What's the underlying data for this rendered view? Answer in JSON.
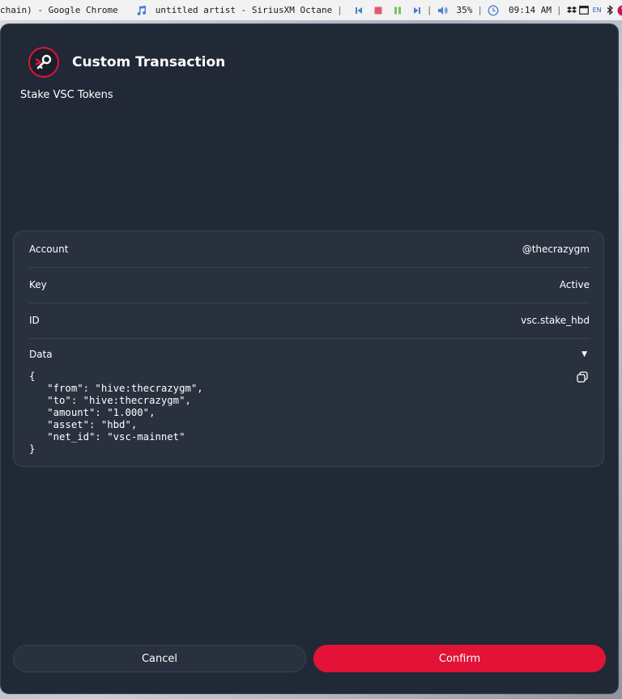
{
  "topbar": {
    "window_title": "chain) - Google Chrome",
    "now_playing": "untitled artist - SiriusXM Octane",
    "volume": "35%",
    "clock": "09:14 AM",
    "lang": "EN"
  },
  "popup": {
    "title": "Custom Transaction",
    "subtitle": "Stake VSC Tokens"
  },
  "details": {
    "account_label": "Account",
    "account_value": "@thecrazygm",
    "key_label": "Key",
    "key_value": "Active",
    "id_label": "ID",
    "id_value": "vsc.stake_hbd",
    "data_label": "Data",
    "data_json": "{\n   \"from\": \"hive:thecrazygm\",\n   \"to\": \"hive:thecrazygm\",\n   \"amount\": \"1.000\",\n   \"asset\": \"hbd\",\n   \"net_id\": \"vsc-mainnet\"\n}"
  },
  "buttons": {
    "cancel": "Cancel",
    "confirm": "Confirm"
  },
  "colors": {
    "accent": "#e31337",
    "panel": "#212937",
    "card": "#29313f"
  },
  "icons": {
    "logo": "key-icon",
    "copy": "copy-icon",
    "caret": "caret-down-icon"
  }
}
